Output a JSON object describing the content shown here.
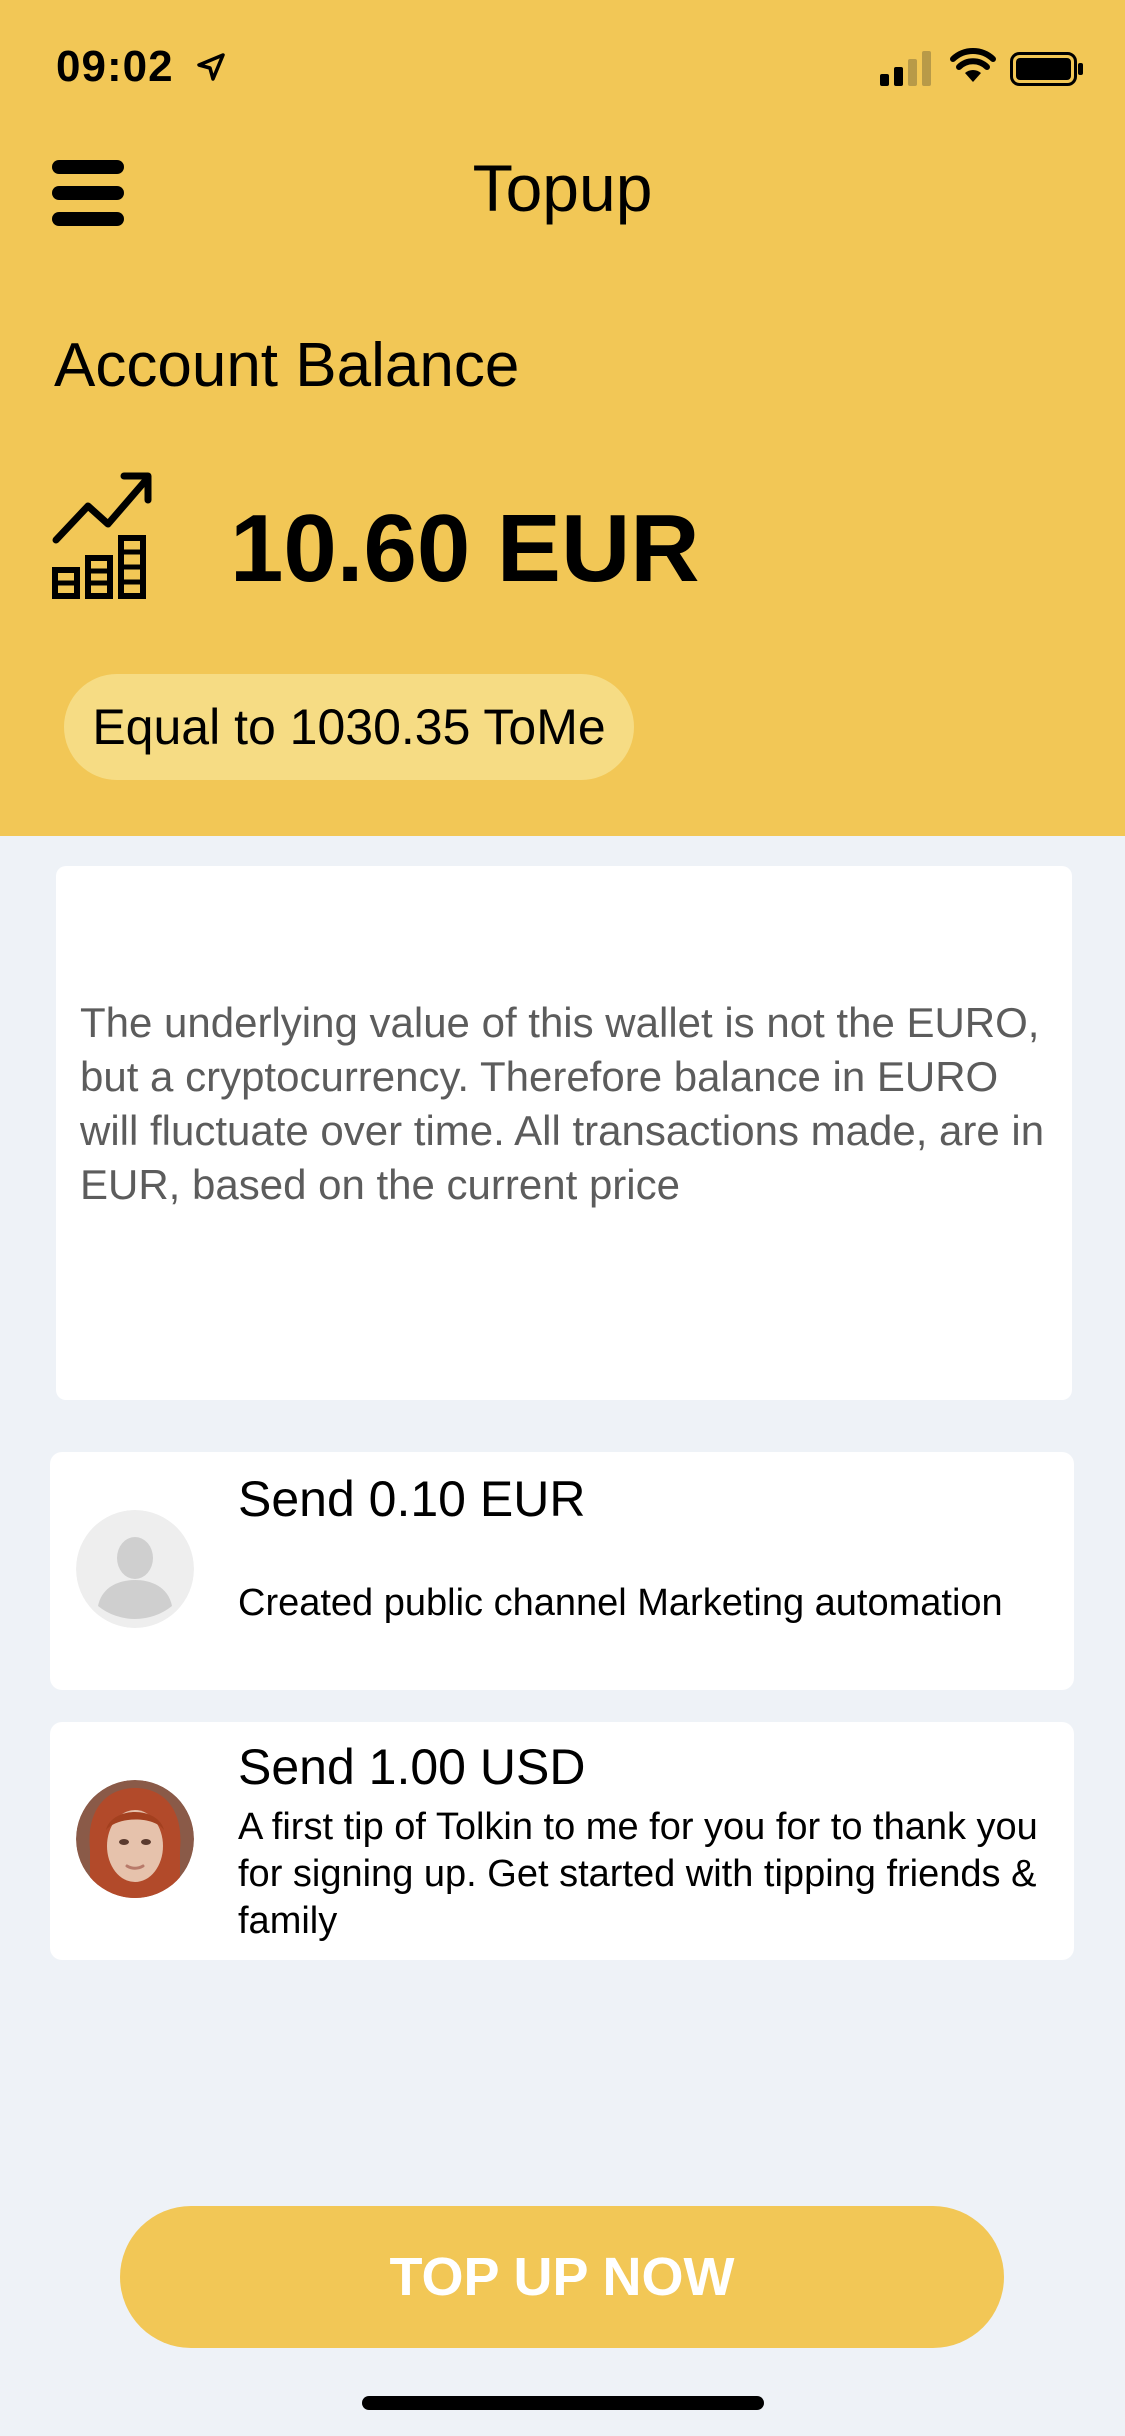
{
  "status_bar": {
    "time": "09:02"
  },
  "header": {
    "title": "Topup",
    "balance_label": "Account Balance",
    "balance_amount": "10.60 EUR",
    "equal_to": "Equal to 1030.35 ToMe"
  },
  "info_card": {
    "text": "The underlying value of this wallet is not the EURO, but a cryptocurrency. Therefore balance in EURO will fluctuate over time. All transactions made, are in EUR, based on the current price"
  },
  "transactions": [
    {
      "title": "Send 0.10 EUR",
      "description": "Created public channel Marketing automation",
      "avatar": "default-user-icon"
    },
    {
      "title": "Send 1.00 USD",
      "description": "A first tip of Tolkin to me for you for to thank you for signing up. Get started with tipping friends & family",
      "avatar": "user-photo"
    }
  ],
  "actions": {
    "topup_label": "TOP UP NOW"
  },
  "colors": {
    "brand_yellow": "#f2c756",
    "pill_yellow": "#f6dc84",
    "background": "#eef2f7"
  }
}
